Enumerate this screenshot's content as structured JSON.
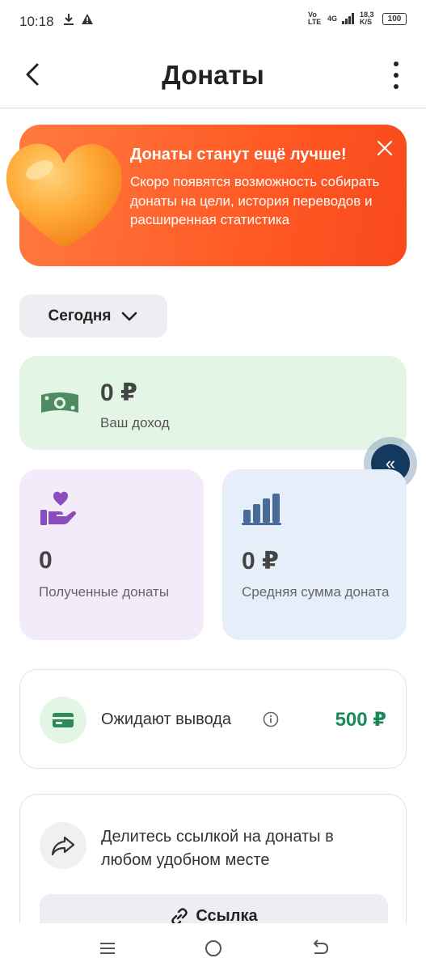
{
  "status_bar": {
    "time": "10:18",
    "network": "Vo LTE",
    "signal": "4G",
    "speed": "18,3 K/S",
    "battery": "100"
  },
  "app_bar": {
    "title": "Донаты"
  },
  "banner": {
    "title": "Донаты станут ещё лучше!",
    "text": "Скоро появятся возможность собирать донаты на цели, история переводов и расширенная статистика"
  },
  "period": {
    "label": "Сегодня"
  },
  "income": {
    "value": "0 ₽",
    "label": "Ваш доход"
  },
  "stats": [
    {
      "value": "0",
      "label": "Полученные донаты"
    },
    {
      "value": "0 ₽",
      "label": "Средняя сумма доната"
    }
  ],
  "pending": {
    "label": "Ожидают вывода",
    "amount": "500 ₽"
  },
  "share": {
    "text": "Делитесь ссылкой на донаты в любом удобном месте",
    "button_label": "Ссылка"
  },
  "colors": {
    "banner": "#ff5a25",
    "income_bg": "#e3f6e6",
    "donations_bg": "#f3ebfa",
    "average_bg": "#e6eefa",
    "pending_amount": "#1a8a5a",
    "float_button": "#13395f"
  }
}
